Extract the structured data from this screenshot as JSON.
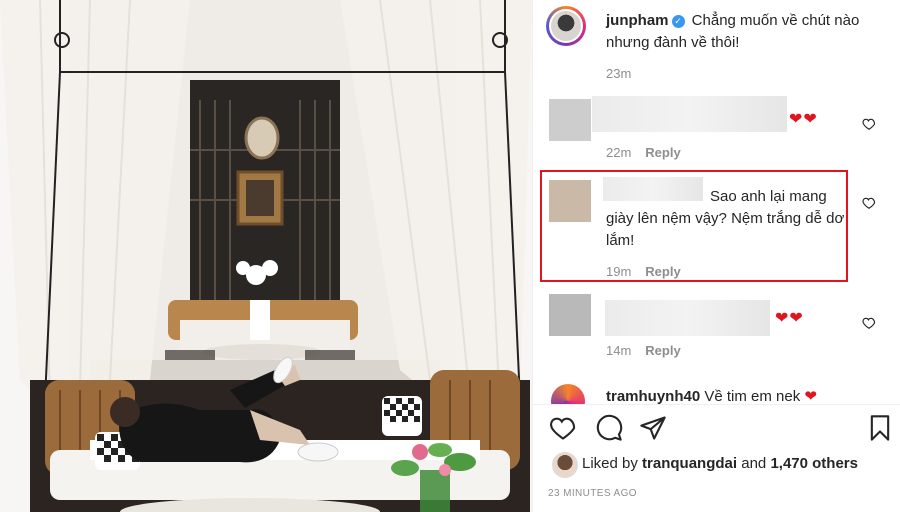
{
  "post": {
    "caption": {
      "username": "junpham",
      "text": "Chẳng muốn về chút nào nhưng đành về thôi!",
      "time": "23m"
    }
  },
  "comments": [
    {
      "time": "22m",
      "reply_label": "Reply",
      "emoji": "❤❤"
    },
    {
      "text": "Sao anh lại mang giày lên nệm vậy? Nệm trắng dễ dơ lắm!",
      "time": "19m",
      "reply_label": "Reply"
    },
    {
      "time": "14m",
      "reply_label": "Reply",
      "emoji": "❤❤"
    },
    {
      "username": "tramhuynh40",
      "text": "Về tim em nek",
      "emoji": "❤"
    }
  ],
  "likes": {
    "prefix": "Liked by",
    "user": "tranquangdai",
    "and": "and",
    "count": "1,470 others"
  },
  "timestamp": "23 MINUTES AGO",
  "icons": [
    "verified-icon",
    "heart-icon",
    "comment-icon",
    "share-icon",
    "bookmark-icon"
  ],
  "colors": {
    "highlight": "#e0161f",
    "verified": "#3897f0",
    "heart": "#e0161f"
  }
}
